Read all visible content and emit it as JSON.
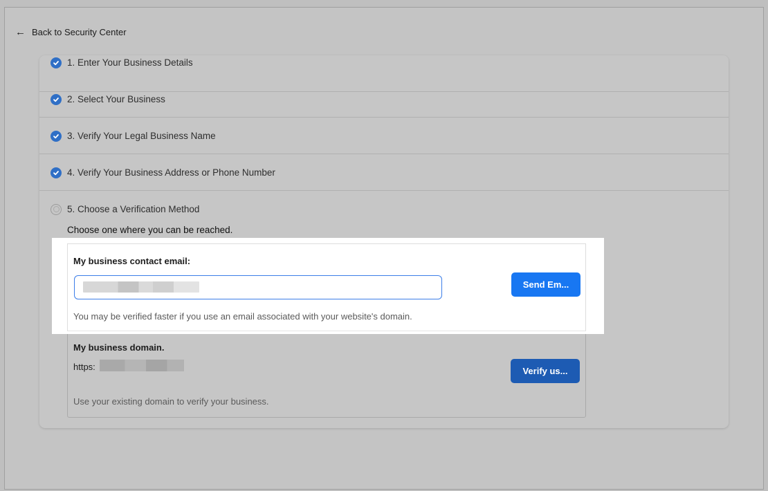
{
  "back_link": {
    "icon": "arrow-left-icon",
    "label": "Back to Security Center"
  },
  "steps": [
    {
      "label": "1. Enter Your Business Details",
      "status": "complete"
    },
    {
      "label": "2. Select Your Business",
      "status": "complete"
    },
    {
      "label": "3. Verify Your Legal Business Name",
      "status": "complete"
    },
    {
      "label": "4. Verify Your Business Address or Phone Number",
      "status": "complete"
    },
    {
      "label": "5. Choose a Verification Method",
      "status": "current"
    }
  ],
  "instruction": "Choose one where you can be reached.",
  "email_option": {
    "title": "My business contact email:",
    "input_value": "",
    "button_label": "Send Em...",
    "helper": "You may be verified faster if you use an email associated with your website's domain."
  },
  "domain_option": {
    "title": "My business domain.",
    "prefix": "https:",
    "button_label": "Verify us...",
    "helper": "Use your existing domain to verify your business."
  },
  "colors": {
    "accent": "#1877f2",
    "check": "#2f6fc6"
  }
}
